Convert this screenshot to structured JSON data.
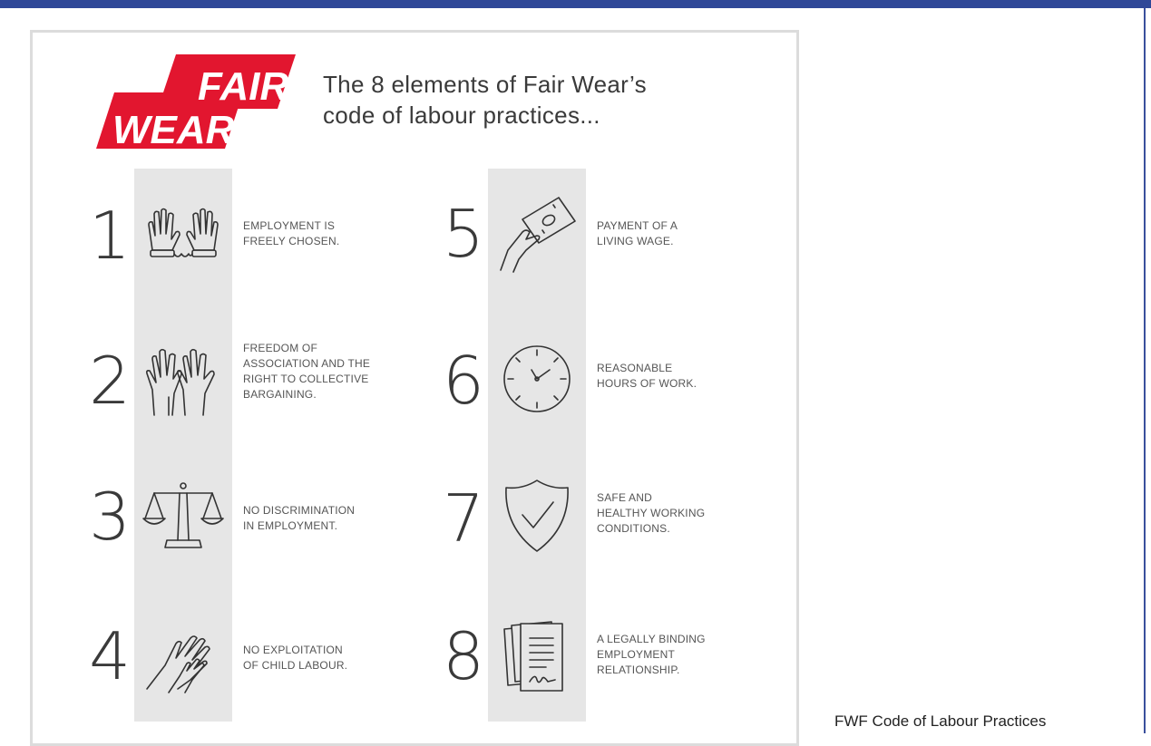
{
  "logo": {
    "line1": "FAIR",
    "line2": "WEAR",
    "color": "#e2162f"
  },
  "heading": {
    "line1": "The 8 elements of Fair Wear’s",
    "line2": "code of labour practices..."
  },
  "elements": [
    {
      "number": "1",
      "icon": "handcuffed-hands-icon",
      "lines": [
        "EMPLOYMENT IS",
        "FREELY CHOSEN."
      ]
    },
    {
      "number": "2",
      "icon": "raised-hands-icon",
      "lines": [
        "FREEDOM OF",
        "ASSOCIATION AND THE",
        "RIGHT TO COLLECTIVE",
        "BARGAINING."
      ]
    },
    {
      "number": "3",
      "icon": "scales-icon",
      "lines": [
        "NO DISCRIMINATION",
        "IN EMPLOYMENT."
      ]
    },
    {
      "number": "4",
      "icon": "adult-and-child-hands-icon",
      "lines": [
        "NO EXPLOITATION",
        "OF CHILD LABOUR."
      ]
    },
    {
      "number": "5",
      "icon": "hand-with-money-icon",
      "lines": [
        "PAYMENT OF A",
        "LIVING WAGE."
      ]
    },
    {
      "number": "6",
      "icon": "clock-icon",
      "lines": [
        "REASONABLE",
        "HOURS OF WORK."
      ]
    },
    {
      "number": "7",
      "icon": "shield-check-icon",
      "lines": [
        "SAFE AND",
        "HEALTHY WORKING",
        "CONDITIONS."
      ]
    },
    {
      "number": "8",
      "icon": "signed-contract-icon",
      "lines": [
        "A LEGALLY BINDING",
        "EMPLOYMENT",
        "RELATIONSHIP."
      ]
    }
  ],
  "caption": "FWF Code of Labour Practices"
}
